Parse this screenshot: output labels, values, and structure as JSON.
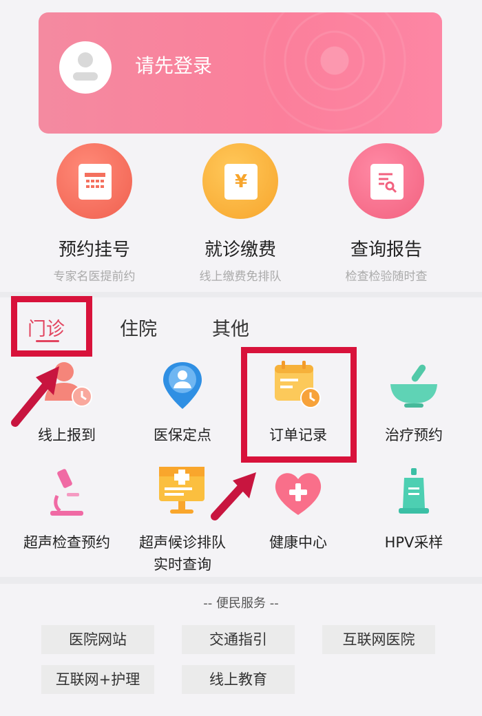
{
  "user": {
    "login_prompt": "请先登录"
  },
  "features": [
    {
      "title": "预约挂号",
      "subtitle": "专家名医提前约",
      "icon": "calendar-icon",
      "color": "#f4705e"
    },
    {
      "title": "就诊缴费",
      "subtitle": "线上缴费免排队",
      "icon": "yen-icon",
      "color": "#fbb440"
    },
    {
      "title": "查询报告",
      "subtitle": "检查检验随时查",
      "icon": "report-search-icon",
      "color": "#f76d8d"
    }
  ],
  "tabs": [
    "门诊",
    "住院",
    "其他"
  ],
  "active_tab": "门诊",
  "services": [
    {
      "label": "线上报到",
      "icon": "check-in-icon"
    },
    {
      "label": "医保定点",
      "icon": "location-person-icon"
    },
    {
      "label": "订单记录",
      "icon": "order-record-icon"
    },
    {
      "label": "治疗预约",
      "icon": "mortar-bowl-icon"
    },
    {
      "label": "超声检查预约",
      "icon": "microscope-icon"
    },
    {
      "label_line1": "超声候诊排队",
      "label_line2": "实时查询",
      "icon": "monitor-icon"
    },
    {
      "label": "健康中心",
      "icon": "heart-plus-icon"
    },
    {
      "label": "HPV采样",
      "icon": "sample-bottle-icon"
    }
  ],
  "convenience": {
    "title": "-- 便民服务 --",
    "buttons": [
      "医院网站",
      "交通指引",
      "互联网医院",
      "互联网+护理",
      "线上教育"
    ]
  },
  "accent_color": "#e2445f",
  "highlight_color": "#d8123b"
}
